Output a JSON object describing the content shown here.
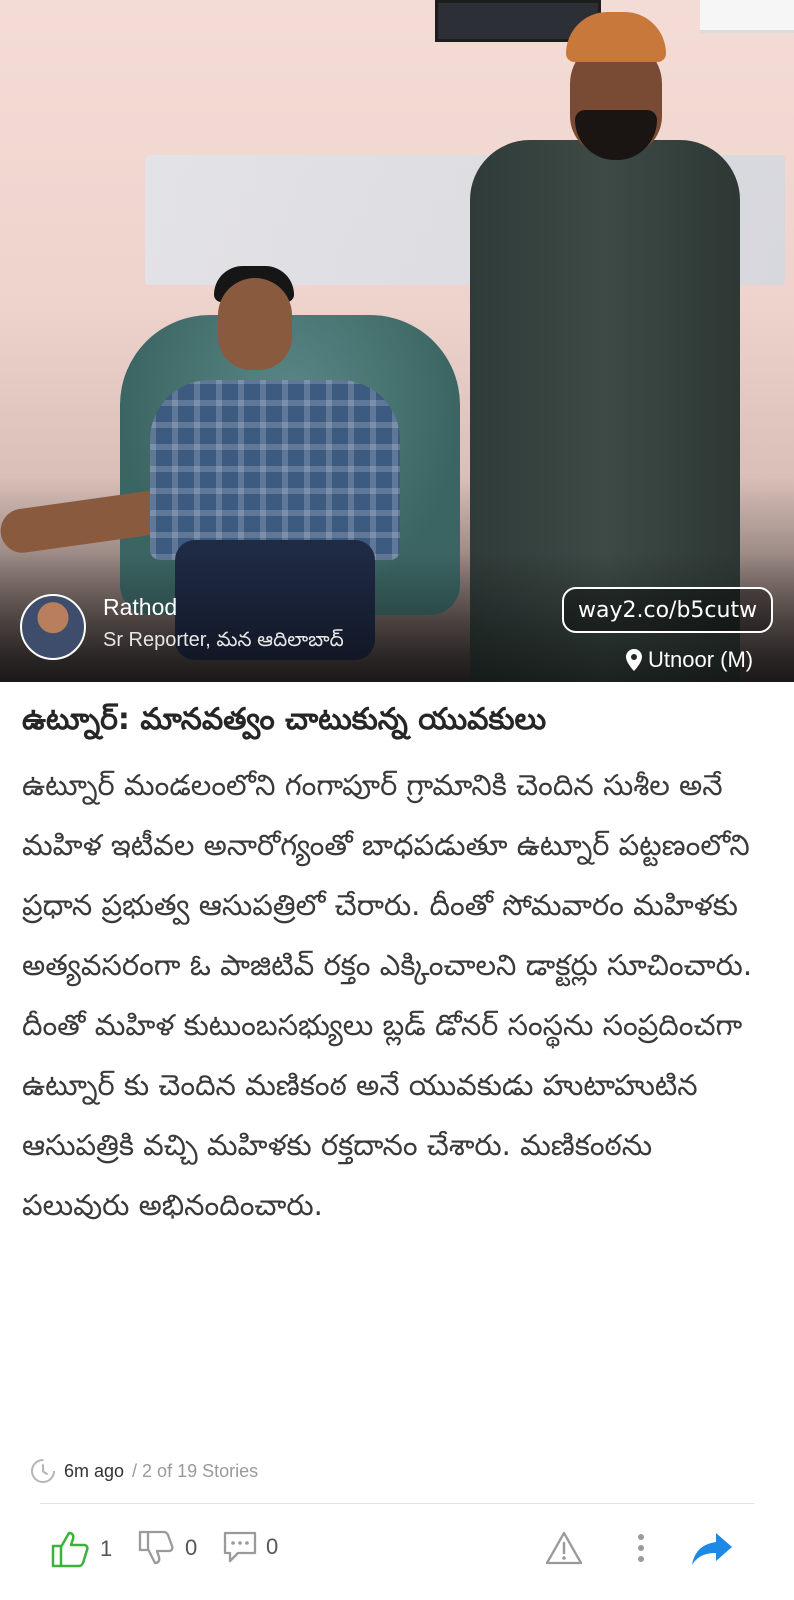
{
  "reporter": {
    "name": "Rathod",
    "role": "Sr Reporter, మన ఆదిలాబాద్"
  },
  "short_link": "way2.co/b5cutw",
  "location": "Utnoor (M)",
  "article": {
    "headline": "ఉట్నూర్: మానవత్వం చాటుకున్న యువకులు",
    "body": "ఉట్నూర్ మండలంలోని గంగాపూర్ గ్రామానికి చెందిన సుశీల అనే మహిళ ఇటీవల అనారోగ్యంతో బాధపడుతూ ఉట్నూర్ పట్టణంలోని ప్రధాన ప్రభుత్వ ఆసుపత్రిలో చేరారు. దీంతో సోమవారం మహిళకు అత్యవసరంగా ఓ పాజిటివ్ రక్తం ఎక్కించాలని డాక్టర్లు సూచించారు. దీంతో మహిళ కుటుంబసభ్యులు బ్లడ్ డోనర్ సంస్థను సంప్రదించగా ఉట్నూర్ కు చెందిన మణికంఠ అనే యువకుడు హుటాహుటిన ఆసుపత్రికి వచ్చి మహిళకు రక్తదానం చేశారు. మణికంఠను పలువురు అభినందించారు."
  },
  "meta": {
    "time": "6m ago",
    "stories": "/ 2 of 19 Stories"
  },
  "actions": {
    "likes": "1",
    "dislikes": "0",
    "comments": "0"
  },
  "colors": {
    "like_green": "#3bb33b",
    "share_blue": "#1e88e5",
    "icon_gray": "#9a9a9a"
  },
  "icons": [
    "pin-icon",
    "clock-icon",
    "thumbs-up-icon",
    "thumbs-down-icon",
    "comment-icon",
    "warning-icon",
    "more-vertical-icon",
    "share-icon"
  ]
}
